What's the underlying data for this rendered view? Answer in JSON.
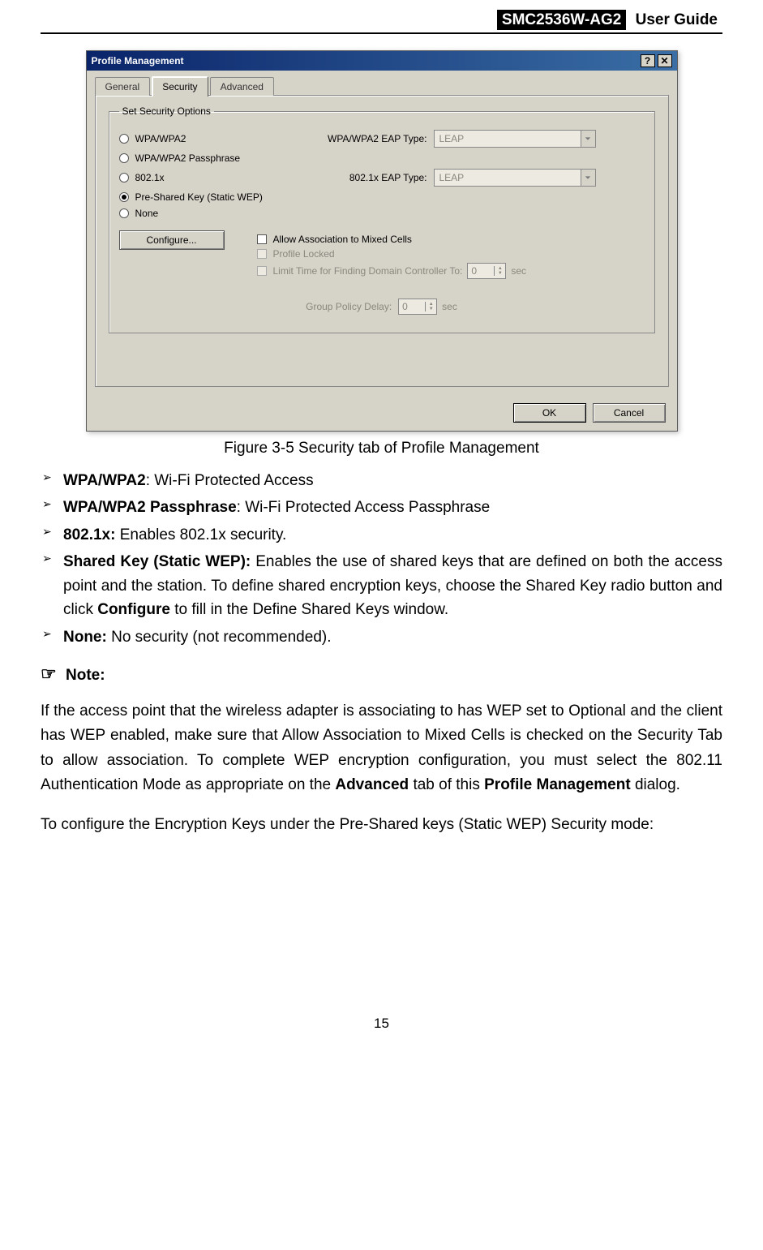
{
  "header": {
    "product": "SMC2536W-AG2",
    "title": "User Guide"
  },
  "dialog": {
    "title": "Profile Management",
    "tabs": {
      "general": "General",
      "security": "Security",
      "advanced": "Advanced"
    },
    "group_legend": "Set Security Options",
    "radios": {
      "wpa": "WPA/WPA2",
      "wpa_pass": "WPA/WPA2 Passphrase",
      "dot1x": "802.1x",
      "psk": "Pre-Shared Key (Static WEP)",
      "none": "None"
    },
    "eap1_label": "WPA/WPA2 EAP Type:",
    "eap2_label": "802.1x EAP Type:",
    "eap_value": "LEAP",
    "configure_btn": "Configure...",
    "cb_mixed": "Allow Association to Mixed Cells",
    "cb_locked": "Profile Locked",
    "cb_limit": "Limit Time for Finding Domain Controller To:",
    "limit_value": "0",
    "limit_unit": "sec",
    "gp_label": "Group Policy Delay:",
    "gp_value": "0",
    "gp_unit": "sec",
    "ok": "OK",
    "cancel": "Cancel"
  },
  "caption": "Figure 3-5 Security tab of Profile Management",
  "bullets": {
    "b1_bold": "WPA/WPA2",
    "b1_text": ": Wi-Fi Protected Access",
    "b2_bold": "WPA/WPA2 Passphrase",
    "b2_text": ": Wi-Fi Protected Access Passphrase",
    "b3_bold": "802.1x:",
    "b3_text": " Enables 802.1x security.",
    "b4_bold": "Shared Key (Static WEP):",
    "b4_text_a": " Enables the use of shared keys that are defined on both the access point and the station. To define shared encryption keys, choose the Shared Key radio button and click ",
    "b4_bold2": "Configure",
    "b4_text_b": " to fill in the Define Shared Keys window.",
    "b5_bold": "None:",
    "b5_text": " No security (not recommended)."
  },
  "note_label": "Note:",
  "note_hand": "☞",
  "note_para_a": "If the access point that the wireless adapter is associating to has WEP set to Optional and the client has WEP enabled, make sure that Allow Association to Mixed Cells is checked on the Security Tab to allow association. To complete WEP encryption configuration, you must select the 802.11 Authentication Mode as appropriate on the ",
  "note_bold1": "Advanced",
  "note_para_b": " tab of this ",
  "note_bold2": "Profile Management",
  "note_para_c": " dialog.",
  "para2": "To configure the Encryption Keys under the Pre-Shared keys (Static WEP) Security mode:",
  "page_number": "15"
}
